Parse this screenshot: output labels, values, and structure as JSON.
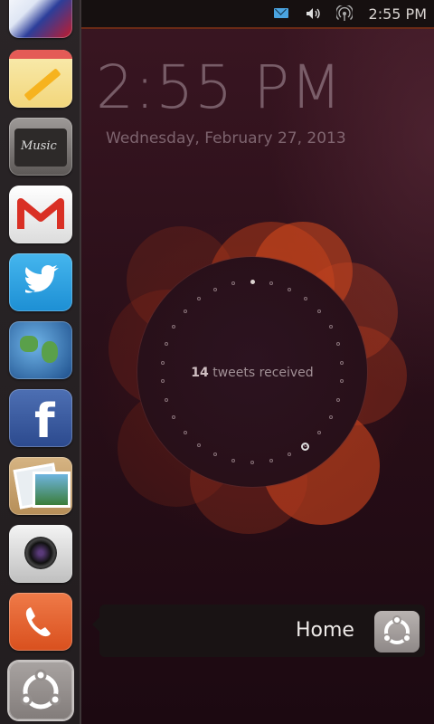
{
  "status_bar": {
    "time": "2:55 PM",
    "icons": [
      "envelope-icon",
      "volume-icon",
      "network-icon"
    ]
  },
  "lockscreen": {
    "clock": "2:55 PM",
    "date": "Wednesday, February 27, 2013",
    "infographic": {
      "count": "14",
      "label": "tweets received"
    }
  },
  "launcher": {
    "apps": [
      "sports-app-icon",
      "notepad-icon",
      "music-icon",
      "gmail-icon",
      "twitter-icon",
      "globe-icon",
      "facebook-icon",
      "photos-icon",
      "camera-icon",
      "phone-icon",
      "ubuntu-home-icon"
    ],
    "music_text": "Music",
    "facebook_letter": "f"
  },
  "home_tooltip": {
    "label": "Home",
    "icon": "ubuntu-logo-icon"
  },
  "colors": {
    "accent": "#e95420",
    "panel": "#161010"
  }
}
